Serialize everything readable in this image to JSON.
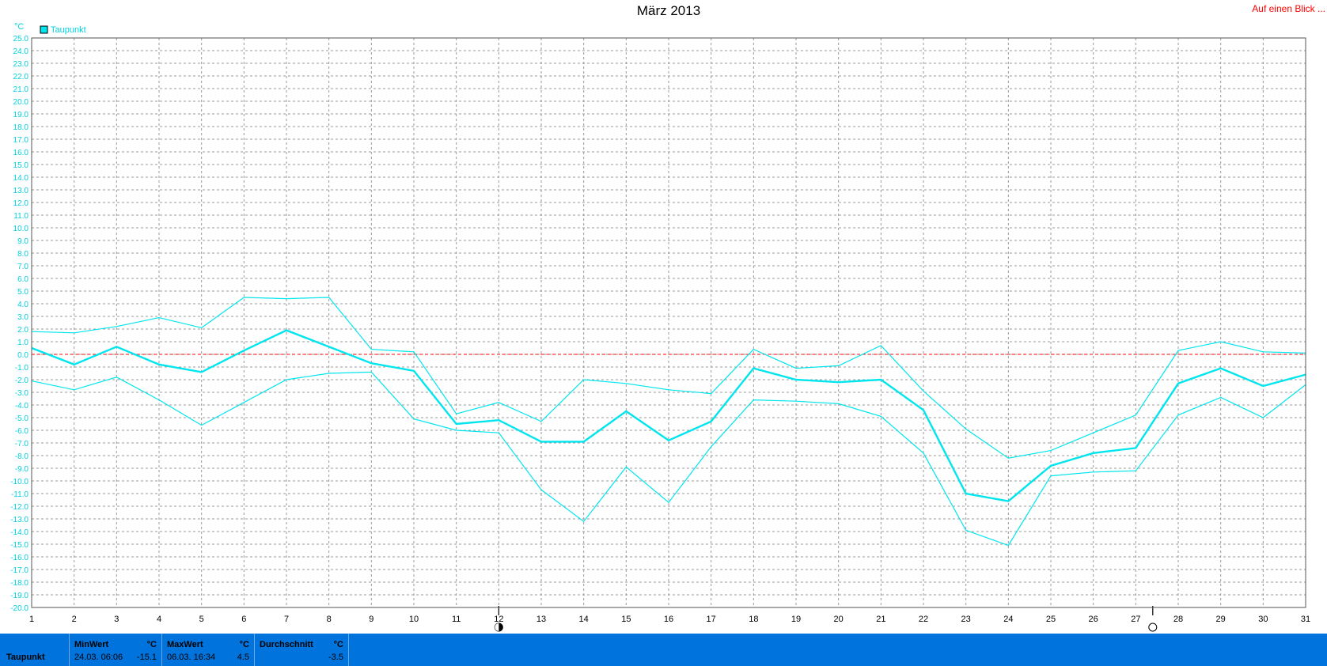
{
  "title": "März 2013",
  "top_link": "Auf einen Blick ...",
  "colors": {
    "series": "#00e5ee",
    "grid": "#9a9a9a",
    "zero_line": "#ff0000",
    "axis_text": "#00d0e0",
    "footer_bg": "#0073dc"
  },
  "chart_data": {
    "type": "line",
    "ylabel": "°C",
    "legend": [
      "Taupunkt"
    ],
    "legend_position": "top-left",
    "grid": true,
    "ylim": [
      -20,
      25
    ],
    "yticks": [
      "25.0",
      "24.0",
      "23.0",
      "22.0",
      "21.0",
      "20.0",
      "19.0",
      "18.0",
      "17.0",
      "16.0",
      "15.0",
      "14.0",
      "13.0",
      "12.0",
      "11.0",
      "10.0",
      "9.0",
      "8.0",
      "7.0",
      "6.0",
      "5.0",
      "4.0",
      "3.0",
      "2.0",
      "1.0",
      "0.0",
      "-1.0",
      "-2.0",
      "-3.0",
      "-4.0",
      "-5.0",
      "-6.0",
      "-7.0",
      "-8.0",
      "-9.0",
      "-10.0",
      "-11.0",
      "-12.0",
      "-13.0",
      "-14.0",
      "-15.0",
      "-16.0",
      "-17.0",
      "-18.0",
      "-19.0",
      "-20.0"
    ],
    "xlim": [
      1,
      31
    ],
    "xticks": [
      "1",
      "2",
      "3",
      "4",
      "5",
      "6",
      "7",
      "8",
      "9",
      "10",
      "11",
      "12",
      "13",
      "14",
      "15",
      "16",
      "17",
      "18",
      "19",
      "20",
      "21",
      "22",
      "23",
      "24",
      "25",
      "26",
      "27",
      "28",
      "29",
      "30",
      "31"
    ],
    "x": [
      1,
      2,
      3,
      4,
      5,
      6,
      7,
      8,
      9,
      10,
      11,
      12,
      13,
      14,
      15,
      16,
      17,
      18,
      19,
      20,
      21,
      22,
      23,
      24,
      25,
      26,
      27,
      28,
      29,
      30,
      31
    ],
    "series": [
      {
        "name": "Taupunkt",
        "role": "mean",
        "values": [
          0.5,
          -0.8,
          0.6,
          -0.8,
          -1.4,
          0.3,
          1.9,
          0.6,
          -0.7,
          -1.3,
          -5.5,
          -5.2,
          -6.9,
          -6.9,
          -4.5,
          -6.8,
          -5.3,
          -1.1,
          -2.0,
          -2.2,
          -2.0,
          -4.4,
          -11.0,
          -11.6,
          -8.8,
          -7.8,
          -7.4,
          -2.3,
          -1.1,
          -2.5,
          -1.6
        ]
      },
      {
        "name": "",
        "role": "max",
        "values": [
          1.8,
          1.7,
          2.2,
          2.9,
          2.1,
          4.5,
          4.4,
          4.5,
          0.4,
          0.2,
          -4.7,
          -3.8,
          -5.3,
          -2.0,
          -2.3,
          -2.8,
          -3.1,
          0.4,
          -1.1,
          -0.9,
          0.7,
          -2.9,
          -5.9,
          -8.2,
          -7.6,
          -6.2,
          -4.8,
          0.3,
          1.0,
          0.2,
          0.1
        ]
      },
      {
        "name": "",
        "role": "min",
        "values": [
          -2.1,
          -2.8,
          -1.8,
          -3.6,
          -5.6,
          -3.8,
          -2.0,
          -1.5,
          -1.4,
          -5.1,
          -6.0,
          -6.2,
          -10.7,
          -13.2,
          -8.9,
          -11.7,
          -7.3,
          -3.6,
          -3.7,
          -3.9,
          -4.9,
          -7.8,
          -13.9,
          -15.1,
          -9.6,
          -9.3,
          -9.2,
          -4.8,
          -3.4,
          -5.0,
          -2.4
        ]
      }
    ],
    "moon_markers": [
      {
        "day": 12,
        "phase": "half-moon"
      },
      {
        "day": 27.4,
        "phase": "full-moon"
      }
    ]
  },
  "footer": {
    "series_label": "Taupunkt",
    "min": {
      "header": "MinWert",
      "unit": "°C",
      "date": "24.03.  06:06",
      "value": "-15.1"
    },
    "max": {
      "header": "MaxWert",
      "unit": "°C",
      "date": "06.03.  16:34",
      "value": "4.5"
    },
    "avg": {
      "header": "Durchschnitt",
      "unit": "°C",
      "value": "-3.5"
    }
  }
}
